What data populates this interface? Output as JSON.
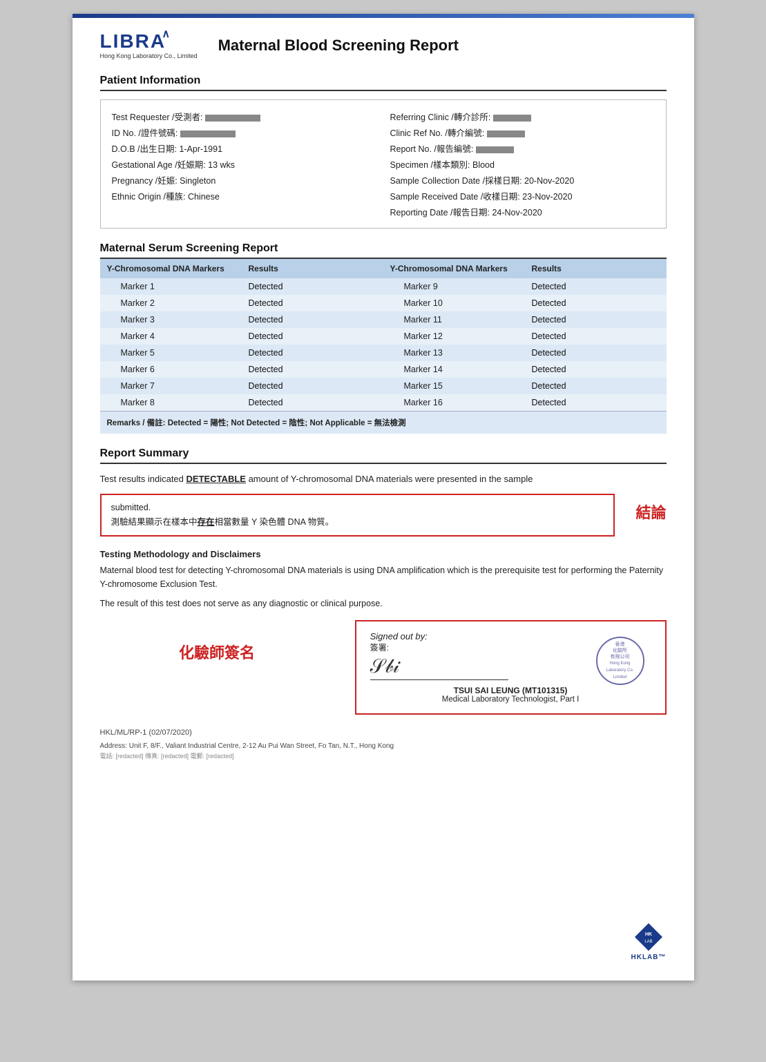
{
  "page": {
    "top_bar_color": "#1a3a8a"
  },
  "header": {
    "logo": "LIBRA",
    "logo_subtitle": "Hong Kong Laboratory Co., Limited",
    "report_title": "Maternal Blood Screening Report"
  },
  "patient_info": {
    "section_label": "Patient Information",
    "fields_left": [
      {
        "label": "Test Requester /受測者:",
        "value": "[redacted]"
      },
      {
        "label": "ID No. /證件號碼:",
        "value": "[redacted]"
      },
      {
        "label": "D.O.B /出生日期:",
        "value": "1-Apr-1991"
      },
      {
        "label": "Gestational Age /妊娠期:",
        "value": "13 wks"
      },
      {
        "label": "Pregnancy /妊娠:",
        "value": "Singleton"
      },
      {
        "label": "Ethnic Origin /種族:",
        "value": "Chinese"
      }
    ],
    "fields_right": [
      {
        "label": "Referring Clinic /轉介診所:",
        "value": "[redacted]"
      },
      {
        "label": "Clinic Ref No. /轉介編號:",
        "value": "[redacted]"
      },
      {
        "label": "Report No. /報告編號:",
        "value": "[redacted]"
      },
      {
        "label": "Specimen /樣本類別:",
        "value": "Blood"
      },
      {
        "label": "Sample Collection Date /採樣日期:",
        "value": "20-Nov-2020"
      },
      {
        "label": "Sample Received Date /收樣日期:",
        "value": "23-Nov-2020"
      },
      {
        "label": "Reporting Date /報告日期:",
        "value": "24-Nov-2020"
      }
    ]
  },
  "serum_section": {
    "section_label": "Maternal Serum Screening Report",
    "col1_header": "Y-Chromosomal DNA Markers",
    "col2_header": "Results",
    "col3_header": "Y-Chromosomal DNA Markers",
    "col4_header": "Results",
    "markers_left": [
      {
        "name": "Marker 1",
        "result": "Detected"
      },
      {
        "name": "Marker 2",
        "result": "Detected"
      },
      {
        "name": "Marker 3",
        "result": "Detected"
      },
      {
        "name": "Marker 4",
        "result": "Detected"
      },
      {
        "name": "Marker 5",
        "result": "Detected"
      },
      {
        "name": "Marker 6",
        "result": "Detected"
      },
      {
        "name": "Marker 7",
        "result": "Detected"
      },
      {
        "name": "Marker 8",
        "result": "Detected"
      }
    ],
    "markers_right": [
      {
        "name": "Marker 9",
        "result": "Detected"
      },
      {
        "name": "Marker 10",
        "result": "Detected"
      },
      {
        "name": "Marker 11",
        "result": "Detected"
      },
      {
        "name": "Marker 12",
        "result": "Detected"
      },
      {
        "name": "Marker 13",
        "result": "Detected"
      },
      {
        "name": "Marker 14",
        "result": "Detected"
      },
      {
        "name": "Marker 15",
        "result": "Detected"
      },
      {
        "name": "Marker 16",
        "result": "Detected"
      }
    ],
    "remarks": "Remarks / 備註: Detected = 陽性; Not Detected = 陰性; Not Applicable = 無法檢測"
  },
  "report_summary": {
    "section_label": "Report Summary",
    "summary_line1": "Test results indicated ",
    "summary_highlight": "DETECTABLE",
    "summary_line2": " amount of Y-chromosomal DNA materials were presented in the sample",
    "submitted_text": "submitted.",
    "chinese_result": "測驗結果顯示在樣本中存在相當數量 Y 染色體 DNA 物質。",
    "chinese_underline": "存在",
    "conclusion_label": "結論"
  },
  "methodology": {
    "title": "Testing Methodology and Disclaimers",
    "para1": "Maternal blood test for detecting Y-chromosomal DNA materials is using DNA amplification which is the prerequisite test for performing the Paternity Y-chromosome Exclusion Test.",
    "para2": "The result of this test does not serve as any diagnostic or clinical purpose."
  },
  "signature": {
    "chemist_label": "化驗師簽名",
    "signed_out_by_en": "Signed out by:",
    "signed_out_by_zh": "簽署:",
    "signer_name": "TSUI SAI LEUNG (MT101315)",
    "signer_title": "Medical Laboratory Technologist, Part I",
    "stamp_text": "香港\n化驗所\n有限公司\nHong Kong\nLaboratory Co.\nLimited"
  },
  "footer": {
    "doc_number": "HKL/ML/RP-1 (02/07/2020)",
    "address": "Address: Unit F, 8/F., Valiant Industrial Centre, 2-12 Au Pui Wan Street, Fo Tan, N.T., Hong Kong",
    "contacts": "電話: [redacted]   傳真: [redacted]   電郵: [redacted]"
  }
}
